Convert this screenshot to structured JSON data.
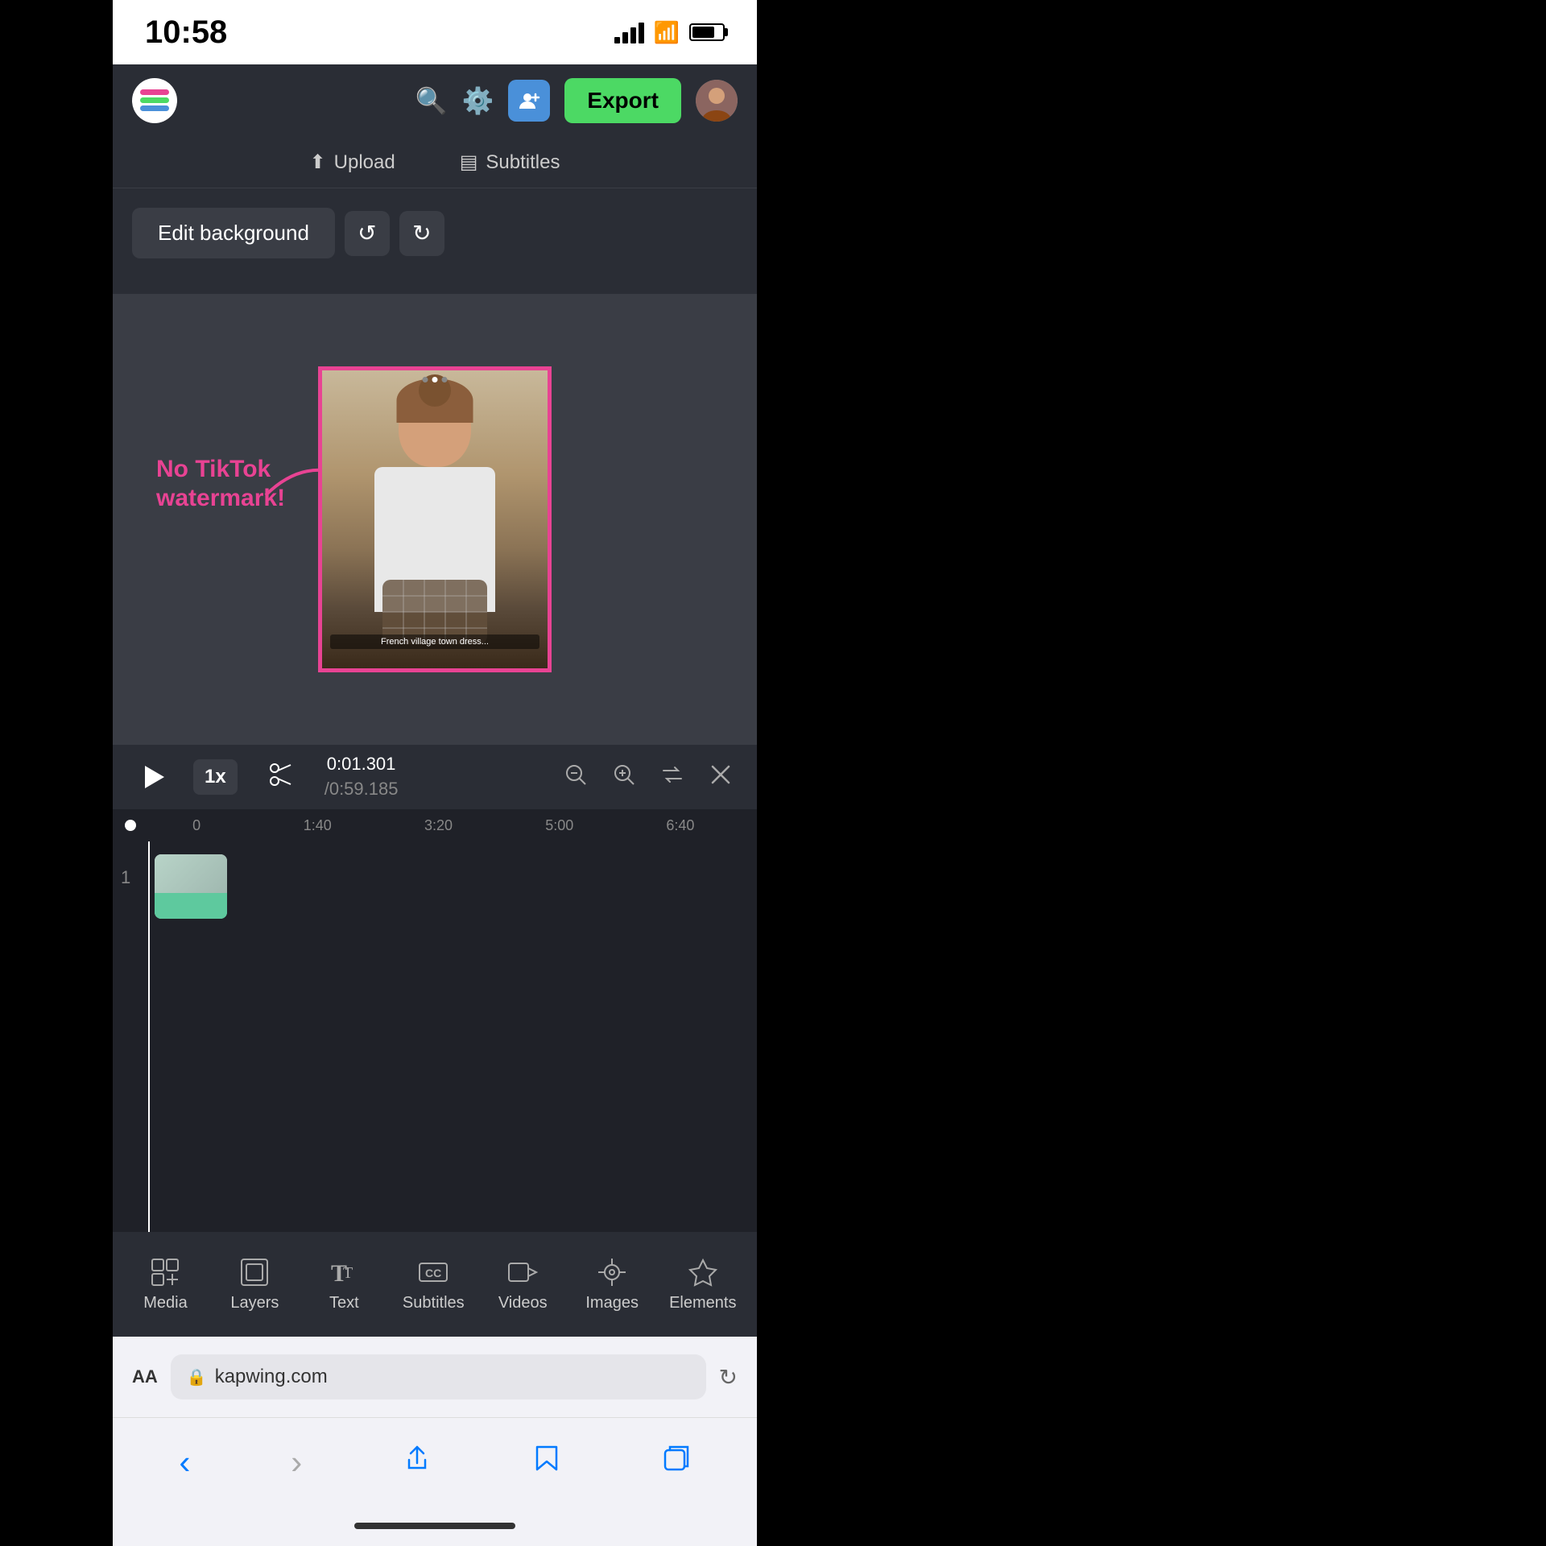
{
  "statusBar": {
    "time": "10:58"
  },
  "header": {
    "exportLabel": "Export",
    "uploadLabel": "Upload",
    "subtitlesLabel": "Subtitles"
  },
  "editControls": {
    "editBgLabel": "Edit background",
    "undoLabel": "↺",
    "redoLabel": "↻"
  },
  "annotation": {
    "noWatermarkLine1": "No TikTok",
    "noWatermarkLine2": "watermark!"
  },
  "videoCaption": {
    "text": "French village town dress..."
  },
  "playback": {
    "currentTime": "0:01.301",
    "totalTime": "0:59.185",
    "speed": "1x"
  },
  "timeline": {
    "markers": [
      "0",
      "1:40",
      "3:20",
      "5:00",
      "6:40"
    ]
  },
  "toolbar": {
    "items": [
      {
        "id": "media",
        "label": "Media",
        "icon": "⊞"
      },
      {
        "id": "layers",
        "label": "Layers",
        "icon": "⧉"
      },
      {
        "id": "text",
        "label": "Text",
        "icon": "Tт"
      },
      {
        "id": "subtitles",
        "label": "Subtitles",
        "icon": "CC"
      },
      {
        "id": "videos",
        "label": "Videos",
        "icon": "▶"
      },
      {
        "id": "images",
        "label": "Images",
        "icon": "⌕"
      },
      {
        "id": "elements",
        "label": "Elements",
        "icon": "✦"
      }
    ]
  },
  "browserBar": {
    "aaLabel": "AA",
    "url": "kapwing.com",
    "lockIcon": "🔒"
  },
  "bottomNav": {
    "back": "‹",
    "forward": "›",
    "share": "⬆",
    "bookmarks": "📖",
    "tabs": "⧉"
  }
}
